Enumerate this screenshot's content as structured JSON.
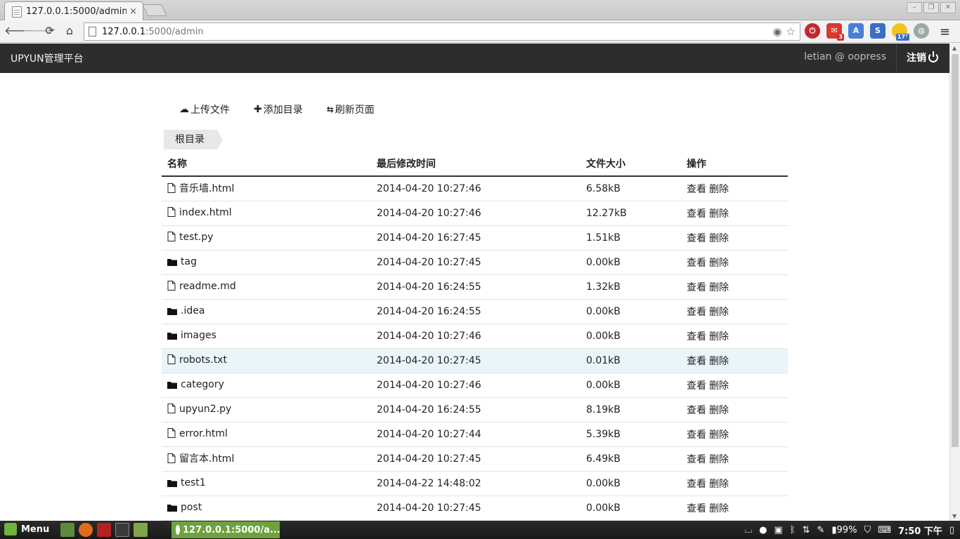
{
  "browser": {
    "tab_title": "127.0.0.1:5000/admin",
    "tab_close": "×",
    "url_host": "127.0.0.1",
    "url_path": ":5000/admin",
    "extension_badges": {
      "mail": "3",
      "weather": "17°"
    }
  },
  "app": {
    "brand": "UPYUN管理平台",
    "user": "letian @ oopress",
    "logout": "注销"
  },
  "actions": {
    "upload": "上传文件",
    "add_dir": "添加目录",
    "refresh": "刷新页面"
  },
  "breadcrumb": {
    "root": "根目录"
  },
  "table": {
    "headers": {
      "name": "名称",
      "time": "最后修改时间",
      "size": "文件大小",
      "ops": "操作"
    },
    "view_label": "查看",
    "delete_label": "删除",
    "rows": [
      {
        "type": "file",
        "name": "音乐墙.html",
        "time": "2014-04-20 10:27:46",
        "size": "6.58kB"
      },
      {
        "type": "file",
        "name": "index.html",
        "time": "2014-04-20 10:27:46",
        "size": "12.27kB"
      },
      {
        "type": "file",
        "name": "test.py",
        "time": "2014-04-20 16:27:45",
        "size": "1.51kB"
      },
      {
        "type": "folder",
        "name": "tag",
        "time": "2014-04-20 10:27:45",
        "size": "0.00kB"
      },
      {
        "type": "file",
        "name": "readme.md",
        "time": "2014-04-20 16:24:55",
        "size": "1.32kB"
      },
      {
        "type": "folder",
        "name": ".idea",
        "time": "2014-04-20 16:24:55",
        "size": "0.00kB"
      },
      {
        "type": "folder",
        "name": "images",
        "time": "2014-04-20 10:27:46",
        "size": "0.00kB"
      },
      {
        "type": "file",
        "name": "robots.txt",
        "time": "2014-04-20 10:27:45",
        "size": "0.01kB",
        "highlight": true
      },
      {
        "type": "folder",
        "name": "category",
        "time": "2014-04-20 10:27:46",
        "size": "0.00kB"
      },
      {
        "type": "file",
        "name": "upyun2.py",
        "time": "2014-04-20 16:24:55",
        "size": "8.19kB"
      },
      {
        "type": "file",
        "name": "error.html",
        "time": "2014-04-20 10:27:44",
        "size": "5.39kB"
      },
      {
        "type": "file",
        "name": "留言本.html",
        "time": "2014-04-20 10:27:45",
        "size": "6.49kB"
      },
      {
        "type": "folder",
        "name": "test1",
        "time": "2014-04-22 14:48:02",
        "size": "0.00kB"
      },
      {
        "type": "folder",
        "name": "post",
        "time": "2014-04-20 10:27:45",
        "size": "0.00kB"
      }
    ]
  },
  "taskbar": {
    "menu_label": "Menu",
    "window_title": "127.0.0.1:5000/a...",
    "battery": "99%",
    "clock": "7:50 下午"
  },
  "colors": {
    "appbar_bg": "#2d2d2d",
    "row_highlight": "#e9f5fa",
    "taskbar_active": "#6fa23f"
  }
}
